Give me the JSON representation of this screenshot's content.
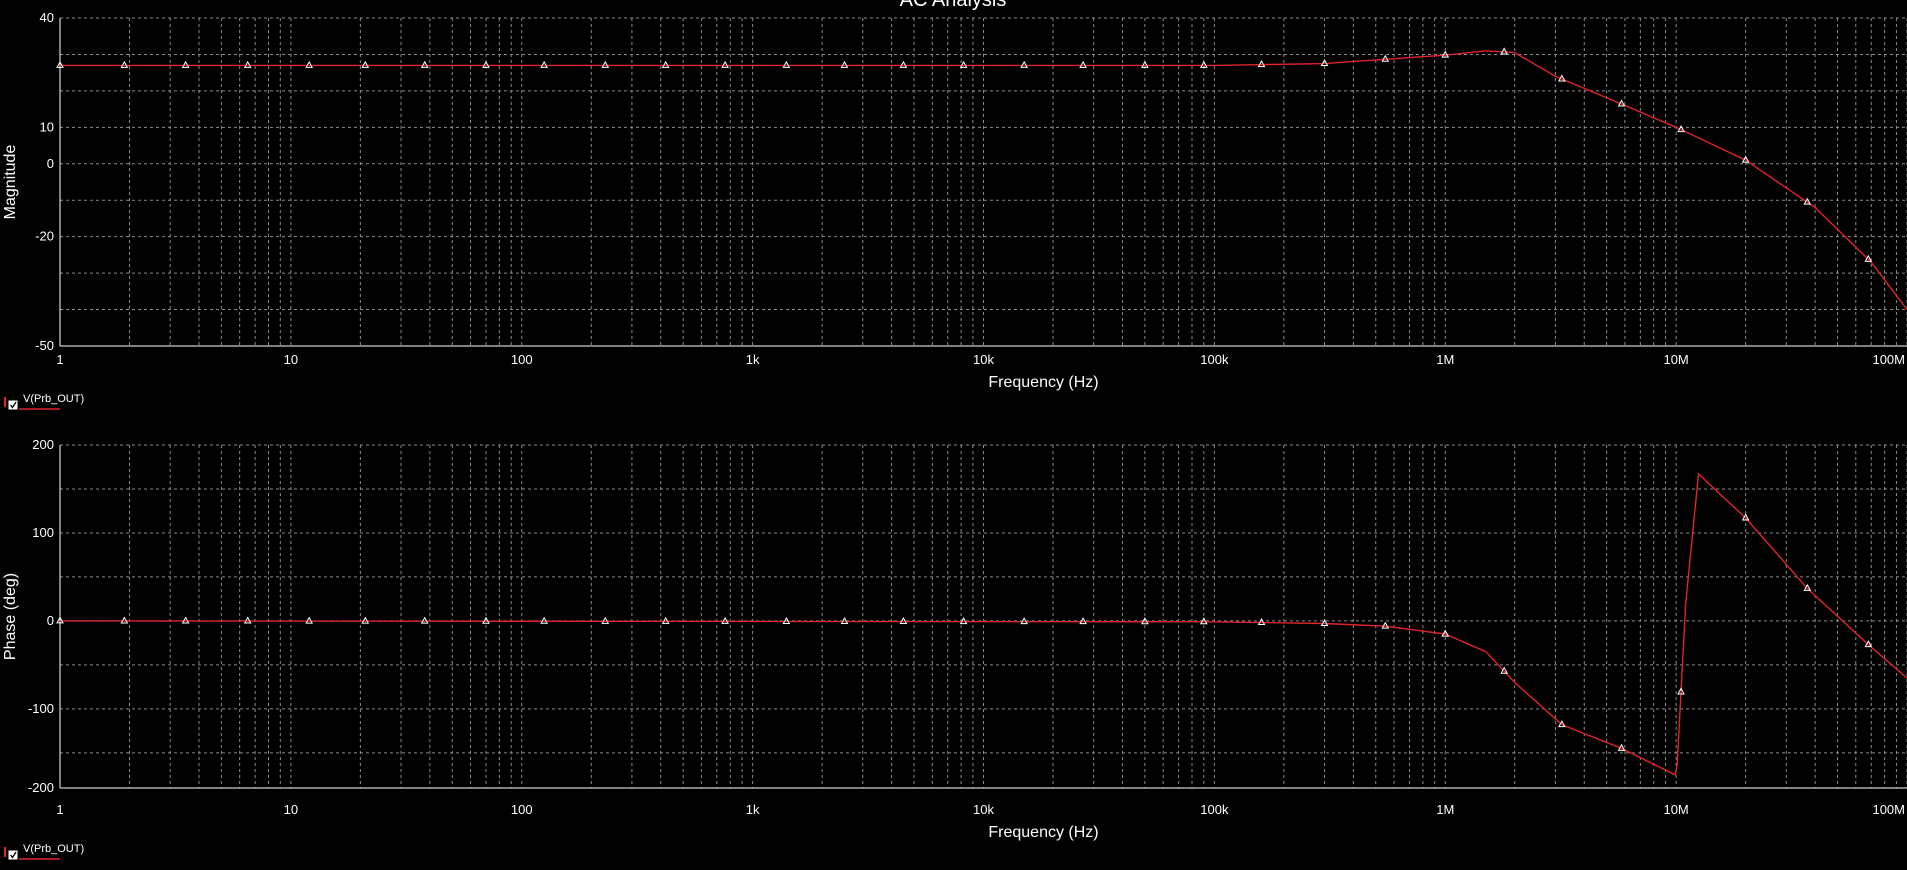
{
  "title": "AC Analysis",
  "colors": {
    "background": "#000000",
    "grid": "#8c8c8c",
    "trace": "#e0242a",
    "text": "#ffffff",
    "marker": "#ffffff"
  },
  "chart_data": [
    {
      "type": "line",
      "title": "AC Analysis",
      "xlabel": "Frequency (Hz)",
      "ylabel": "Magnitude",
      "xscale": "log",
      "xlim": [
        1,
        100000000
      ],
      "ylim": [
        -50,
        40
      ],
      "grid": true,
      "xticks": [
        {
          "value": 1,
          "label": "1"
        },
        {
          "value": 10,
          "label": "10"
        },
        {
          "value": 100,
          "label": "100"
        },
        {
          "value": 1000,
          "label": "1k"
        },
        {
          "value": 10000,
          "label": "10k"
        },
        {
          "value": 100000,
          "label": "100k"
        },
        {
          "value": 1000000,
          "label": "1M"
        },
        {
          "value": 10000000,
          "label": "10M"
        },
        {
          "value": 100000000,
          "label": "100M"
        }
      ],
      "yticks": [
        {
          "value": 40,
          "label": "40"
        },
        {
          "value": 10,
          "label": "10"
        },
        {
          "value": 0,
          "label": "0"
        },
        {
          "value": -20,
          "label": "-20"
        },
        {
          "value": -50,
          "label": "-50"
        }
      ],
      "ygrid": [
        40,
        30,
        20,
        10,
        0,
        -10,
        -20,
        -30,
        -40,
        -50
      ],
      "legend": {
        "position": "bottom-left",
        "entries": [
          "V(Prb_OUT)"
        ]
      },
      "series": [
        {
          "name": "V(Prb_OUT)",
          "x": [
            1,
            1000,
            100000,
            300000,
            500000,
            1000000,
            1500000,
            2000000,
            3000000,
            6000000,
            10000000,
            20000000,
            40000000,
            70000000,
            100000000
          ],
          "y": [
            27,
            27,
            27,
            27.5,
            28.5,
            29.8,
            31,
            30.5,
            24,
            16,
            10,
            1,
            -12,
            -27,
            -40
          ]
        }
      ],
      "markers": [
        1,
        1.9,
        3.5,
        6.5,
        12,
        21,
        38,
        70,
        125,
        230,
        420,
        760,
        1400,
        2500,
        4500,
        8200,
        15000,
        27000,
        50000,
        90000,
        160000,
        300000,
        550000,
        1000000,
        1800000,
        3200000,
        5800000,
        10500000,
        20000000,
        37000000,
        68000000
      ]
    },
    {
      "type": "line",
      "title": "",
      "xlabel": "Frequency (Hz)",
      "ylabel": "Phase (deg)",
      "xscale": "log",
      "xlim": [
        1,
        100000000
      ],
      "ylim": [
        -190,
        200
      ],
      "grid": true,
      "xticks": [
        {
          "value": 1,
          "label": "1"
        },
        {
          "value": 10,
          "label": "10"
        },
        {
          "value": 100,
          "label": "100"
        },
        {
          "value": 1000,
          "label": "1k"
        },
        {
          "value": 10000,
          "label": "10k"
        },
        {
          "value": 100000,
          "label": "100k"
        },
        {
          "value": 1000000,
          "label": "1M"
        },
        {
          "value": 10000000,
          "label": "10M"
        },
        {
          "value": 100000000,
          "label": "100M"
        }
      ],
      "yticks": [
        {
          "value": 200,
          "label": "200"
        },
        {
          "value": 100,
          "label": "100"
        },
        {
          "value": 0,
          "label": "0"
        },
        {
          "value": -100,
          "label": "-100"
        },
        {
          "value": -190,
          "label": "-200"
        }
      ],
      "ygrid": [
        200,
        150,
        100,
        50,
        0,
        -50,
        -100,
        -150,
        -190
      ],
      "legend": {
        "position": "bottom-left",
        "entries": [
          "V(Prb_OUT)"
        ]
      },
      "series": [
        {
          "name": "V(Prb_OUT)",
          "x": [
            1,
            100000,
            300000,
            550000,
            1000000,
            1500000,
            2000000,
            3200000,
            5800000,
            9900000,
            10100000,
            11000000,
            12500000,
            20000000,
            37000000,
            68000000,
            100000000
          ],
          "y": [
            0,
            -1,
            -3,
            -6,
            -15,
            -35,
            -70,
            -118,
            -145,
            -175,
            -165,
            20,
            167,
            117,
            37,
            -27,
            -65
          ]
        }
      ],
      "markers": [
        1,
        1.9,
        3.5,
        6.5,
        12,
        21,
        38,
        70,
        125,
        230,
        420,
        760,
        1400,
        2500,
        4500,
        8200,
        15000,
        27000,
        50000,
        90000,
        160000,
        300000,
        550000,
        1000000,
        1800000,
        3200000,
        5800000,
        10500000,
        20000000,
        37000000,
        68000000
      ]
    }
  ]
}
